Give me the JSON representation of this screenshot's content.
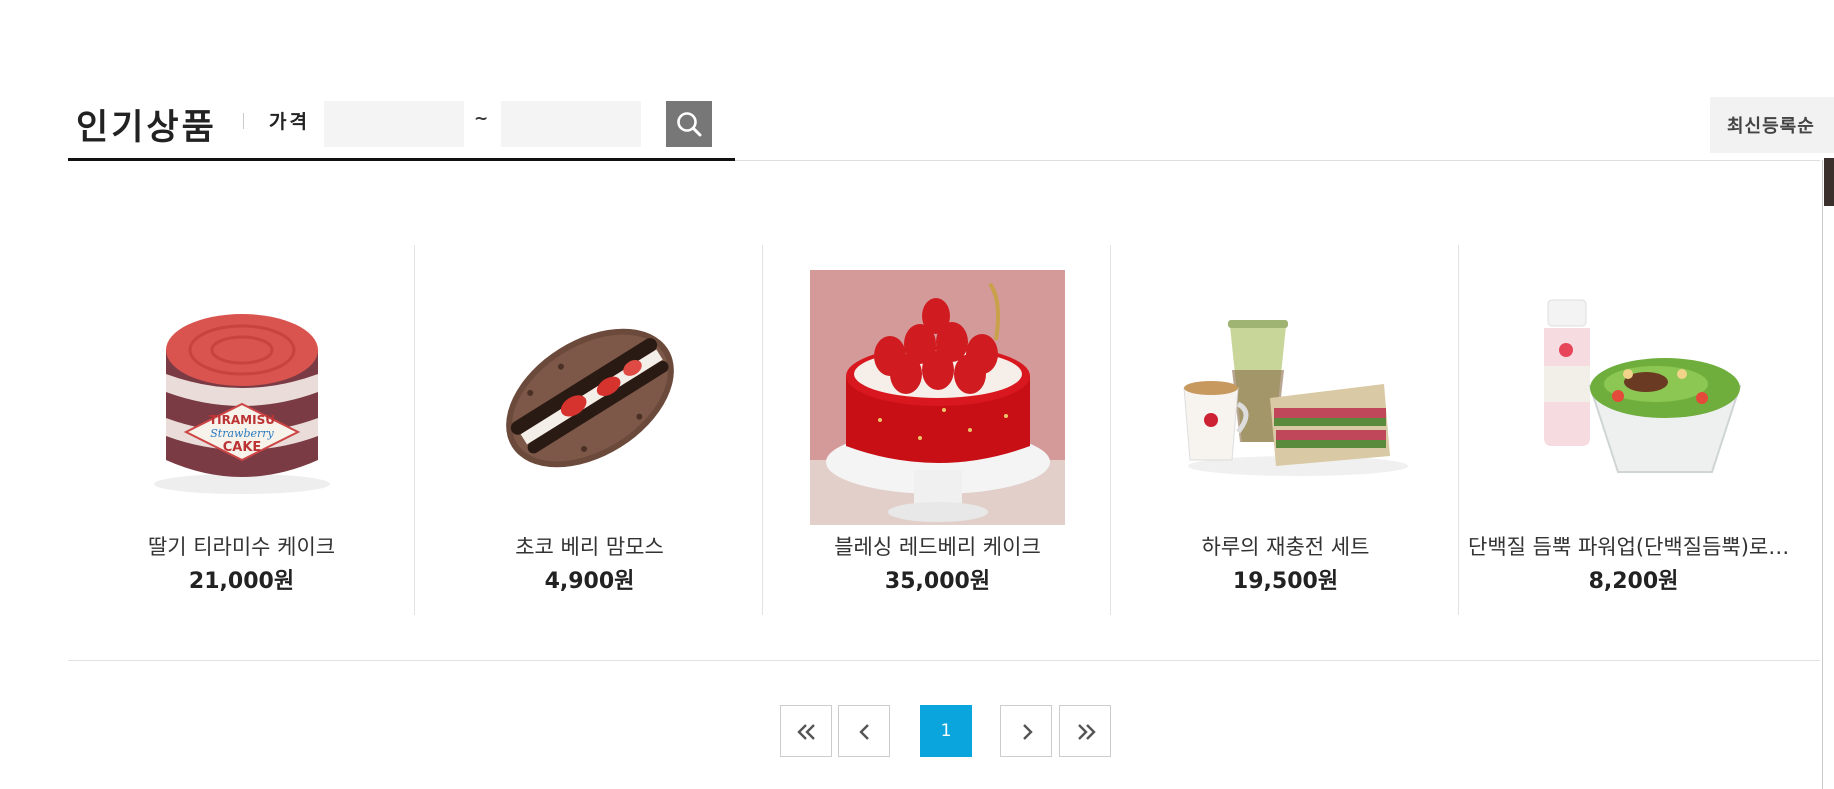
{
  "header": {
    "title": "인기상품",
    "price_label": "가격",
    "price_min": {
      "value": "",
      "placeholder": ""
    },
    "price_separator": "~",
    "price_max": {
      "value": "",
      "placeholder": ""
    },
    "search_icon": "search-icon"
  },
  "sort": {
    "label": "최신등록순"
  },
  "products": [
    {
      "name": "딸기 티라미수 케이크",
      "price": "21,000원",
      "image": "strawberry-tiramisu-cake",
      "image_text": [
        "TIRAMISU",
        "Strawberry",
        "CAKE"
      ]
    },
    {
      "name": "초코 베리 맘모스",
      "price": "4,900원",
      "image": "choco-berry-mammoth-bread"
    },
    {
      "name": "블레싱 레드베리 케이크",
      "price": "35,000원",
      "image": "blessing-redberry-cake"
    },
    {
      "name": "하루의 재충전 세트",
      "price": "19,500원",
      "image": "recharge-set-sandwich-coffee"
    },
    {
      "name": "단백질 듬뿍 파워업(단백질듬뿍)로스...",
      "price": "8,200원",
      "image": "protein-salad-yogurt"
    }
  ],
  "pagination": {
    "first_icon": "double-chevron-left-icon",
    "prev_icon": "chevron-left-icon",
    "current_page": "1",
    "next_icon": "chevron-right-icon",
    "last_icon": "double-chevron-right-icon"
  },
  "colors": {
    "accent": "#0aa5dd",
    "search_button": "#777777",
    "title_underline": "#111111",
    "scroll_thumb": "#3b302b"
  }
}
